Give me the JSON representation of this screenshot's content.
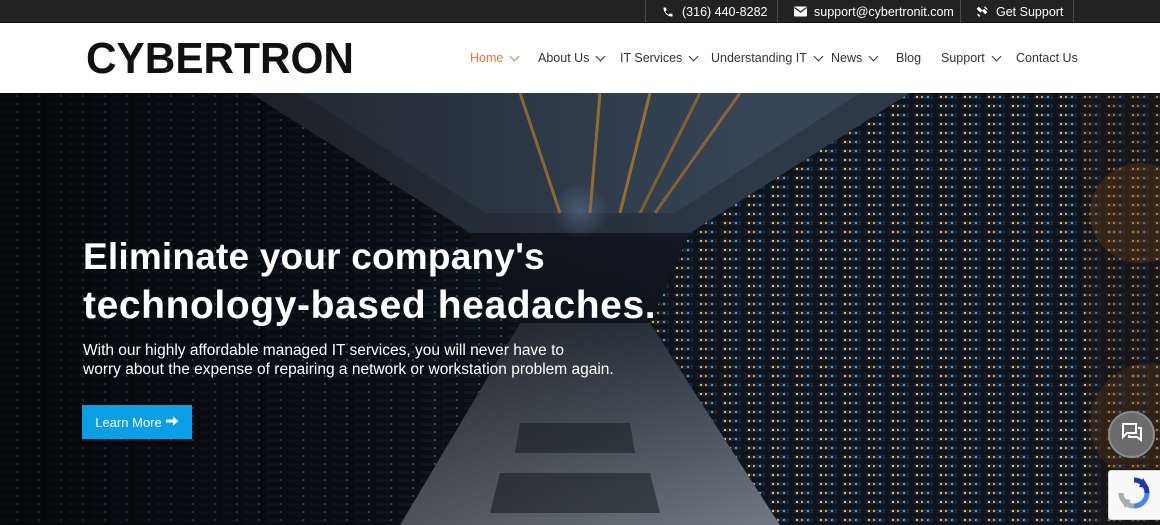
{
  "topbar": {
    "phone": "(316) 440-8282",
    "email": "support@cybertronit.com",
    "support": "Get Support",
    "icons": [
      "phone-icon",
      "envelope-icon",
      "tools-icon"
    ]
  },
  "header": {
    "logo_text": "CYBERTRON",
    "nav": [
      {
        "label": "Home",
        "active": true,
        "dropdown": true
      },
      {
        "label": "About Us",
        "dropdown": true
      },
      {
        "label": "IT Services",
        "dropdown": true
      },
      {
        "label": "Understanding IT",
        "dropdown": true
      },
      {
        "label": "News",
        "dropdown": true
      },
      {
        "label": "Blog",
        "dropdown": false
      },
      {
        "label": "Support",
        "dropdown": true
      },
      {
        "label": "Contact Us",
        "dropdown": false
      }
    ]
  },
  "hero": {
    "title_line1": "Eliminate your company's",
    "title_line2": "technology-based headaches.",
    "subtitle_line1": "With our highly affordable managed IT services, you will never have to",
    "subtitle_line2": "worry about the expense of repairing a network or workstation problem again.",
    "cta_label": "Learn More",
    "cta_icon": "arrow-right-icon"
  },
  "widgets": {
    "chat_icon": "chat-icon",
    "recaptcha_icon": "recaptcha-icon"
  },
  "colors": {
    "accent": "#e3782d",
    "cta": "#0b9fe6",
    "topbar": "#222222",
    "nav_text": "#333333"
  }
}
